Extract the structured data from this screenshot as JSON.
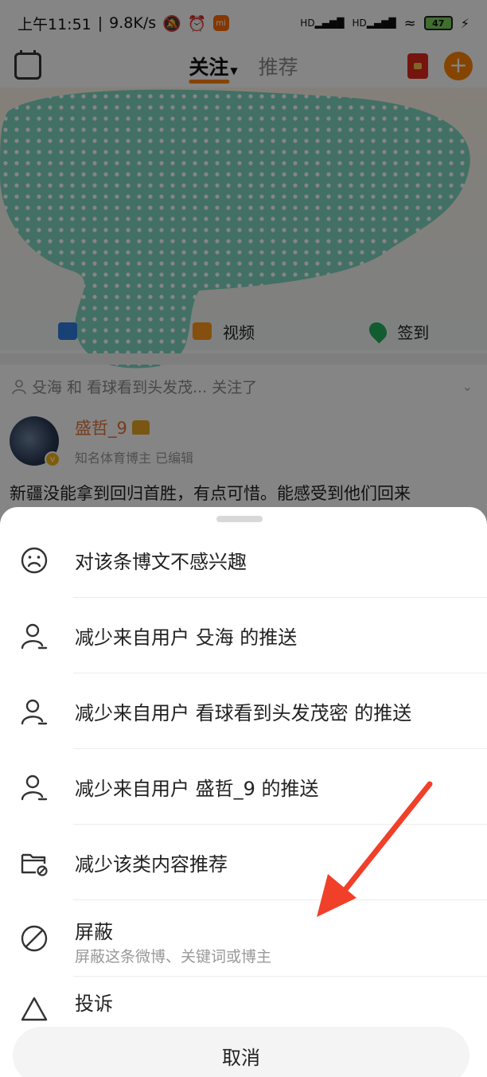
{
  "status_bar": {
    "time": "上午11:51",
    "net_speed": "9.8K/s",
    "battery": "47",
    "mi_label": "mi"
  },
  "top_nav": {
    "tab_following": "关注",
    "tab_recommend": "推荐",
    "active_tab": "关注"
  },
  "quick_bar": {
    "video": "视频",
    "checkin": "签到"
  },
  "feed": {
    "follow_line": "殳海 和 看球看到头发茂... 关注了",
    "post": {
      "author": "盛哲_9",
      "subtitle": "知名体育博主  已编辑",
      "text": "新疆没能拿到回归首胜，有点可惜。能感受到他们回来"
    }
  },
  "sheet": {
    "items": [
      {
        "label": "对该条博文不感兴趣",
        "icon": "sad-face-icon"
      },
      {
        "label": "减少来自用户 殳海 的推送",
        "icon": "user-minus-icon"
      },
      {
        "label": "减少来自用户 看球看到头发茂密 的推送",
        "icon": "user-minus-icon"
      },
      {
        "label": "减少来自用户 盛哲_9 的推送",
        "icon": "user-minus-icon"
      },
      {
        "label": "减少该类内容推荐",
        "icon": "folder-block-icon"
      },
      {
        "label": "屏蔽",
        "sub": "屏蔽这条微博、关键词或博主",
        "icon": "block-icon"
      },
      {
        "label": "投诉",
        "icon": "warning-icon"
      }
    ],
    "cancel": "取消"
  },
  "colors": {
    "accent": "#ff8200",
    "annotation_arrow": "#f0402a",
    "scribble": "#7fd6c2"
  }
}
